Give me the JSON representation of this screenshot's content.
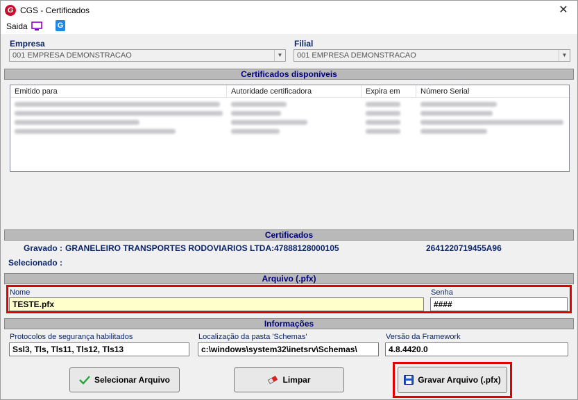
{
  "window": {
    "title": "CGS - Certificados",
    "close_glyph": "✕",
    "app_icon_letter": "G"
  },
  "menu": {
    "saida": "Saida"
  },
  "empresa": {
    "label": "Empresa",
    "value": "001 EMPRESA DEMONSTRACAO"
  },
  "filial": {
    "label": "Filial",
    "value": "001 EMPRESA DEMONSTRACAO"
  },
  "sections": {
    "disponiveis": "Certificados disponíveis",
    "certificados": "Certificados",
    "arquivo": "Arquivo (.pfx)",
    "informacoes": "Informações"
  },
  "cert_table": {
    "columns": [
      "Emitido para",
      "Autoridade certificadora",
      "Expira em",
      "Número Serial"
    ]
  },
  "certificados": {
    "gravado_label": "Gravado :",
    "gravado_value": "GRANELEIRO TRANSPORTES RODOVIARIOS LTDA:47888128000105",
    "gravado_serial": "2641220719455A96",
    "selecionado_label": "Selecionado :"
  },
  "arquivo": {
    "nome_label": "Nome",
    "nome_value": "TESTE.pfx",
    "senha_label": "Senha",
    "senha_value": "####"
  },
  "informacoes": {
    "protocolos_label": "Protocolos de segurança habilitados",
    "protocolos_value": "Ssl3, Tls, Tls11, Tls12, Tls13",
    "schemas_label": "Localização da pasta 'Schemas'",
    "schemas_value": "c:\\windows\\system32\\inetsrv\\Schemas\\",
    "framework_label": "Versão da Framework",
    "framework_value": "4.8.4420.0"
  },
  "buttons": {
    "selecionar": "Selecionar Arquivo",
    "limpar": "Limpar",
    "gravar": "Gravar Arquivo (.pfx)"
  },
  "colors": {
    "highlight_red": "#e00000",
    "label_blue": "#0a246a",
    "header_blue": "#00007f"
  }
}
